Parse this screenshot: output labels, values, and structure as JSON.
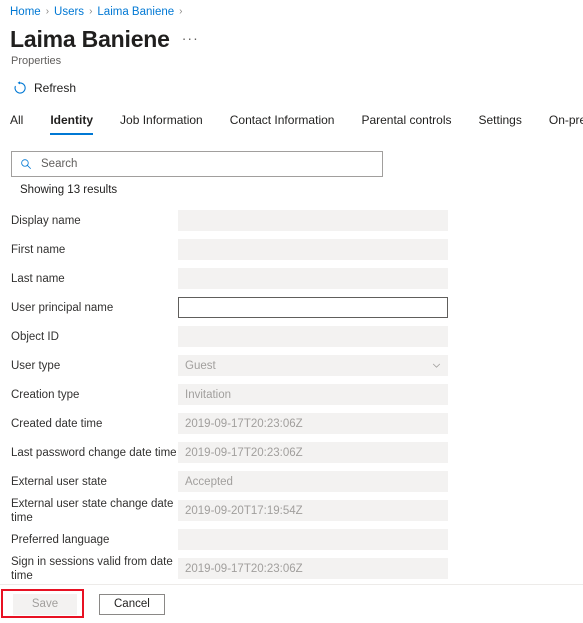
{
  "breadcrumb": {
    "items": [
      {
        "label": "Home"
      },
      {
        "label": "Users"
      },
      {
        "label": "Laima Baniene"
      }
    ],
    "separator": "›",
    "trailing_separator": "›",
    "link_color": "#0078d4"
  },
  "header": {
    "title": "Laima Baniene",
    "more_label": "···",
    "subtitle": "Properties"
  },
  "command_bar": {
    "refresh_label": "Refresh",
    "refresh_icon": "refresh-icon",
    "icon_color": "#0078d4"
  },
  "tabs": {
    "items": [
      {
        "label": "All",
        "active": false
      },
      {
        "label": "Identity",
        "active": true
      },
      {
        "label": "Job Information",
        "active": false
      },
      {
        "label": "Contact Information",
        "active": false
      },
      {
        "label": "Parental controls",
        "active": false
      },
      {
        "label": "Settings",
        "active": false
      },
      {
        "label": "On-premises",
        "active": false
      }
    ],
    "active_underline_color": "#0078d4"
  },
  "search": {
    "placeholder": "Search",
    "value": "",
    "icon": "search-icon",
    "icon_color": "#0078d4"
  },
  "results": {
    "count_text": "Showing 13 results"
  },
  "form": {
    "fields": [
      {
        "label": "Display name",
        "value": "",
        "state": "disabled",
        "type": "text"
      },
      {
        "label": "First name",
        "value": "",
        "state": "disabled",
        "type": "text"
      },
      {
        "label": "Last name",
        "value": "",
        "state": "disabled",
        "type": "text"
      },
      {
        "label": "User principal name",
        "value": "",
        "state": "editable",
        "type": "text"
      },
      {
        "label": "Object ID",
        "value": "",
        "state": "disabled",
        "type": "text"
      },
      {
        "label": "User type",
        "value": "Guest",
        "state": "disabled",
        "type": "dropdown"
      },
      {
        "label": "Creation type",
        "value": "Invitation",
        "state": "disabled",
        "type": "text"
      },
      {
        "label": "Created date time",
        "value": "2019-09-17T20:23:06Z",
        "state": "disabled",
        "type": "text"
      },
      {
        "label": "Last password change date time",
        "value": "2019-09-17T20:23:06Z",
        "state": "disabled",
        "type": "text"
      },
      {
        "label": "External user state",
        "value": "Accepted",
        "state": "disabled",
        "type": "text"
      },
      {
        "label": "External user state change date time",
        "value": "2019-09-20T17:19:54Z",
        "state": "disabled",
        "type": "text"
      },
      {
        "label": "Preferred language",
        "value": "",
        "state": "disabled",
        "type": "text"
      },
      {
        "label": "Sign in sessions valid from date time",
        "value": "2019-09-17T20:23:06Z",
        "state": "disabled",
        "type": "text"
      }
    ]
  },
  "footer": {
    "save_label": "Save",
    "save_disabled": true,
    "cancel_label": "Cancel",
    "annotation_color": "#e81123"
  }
}
